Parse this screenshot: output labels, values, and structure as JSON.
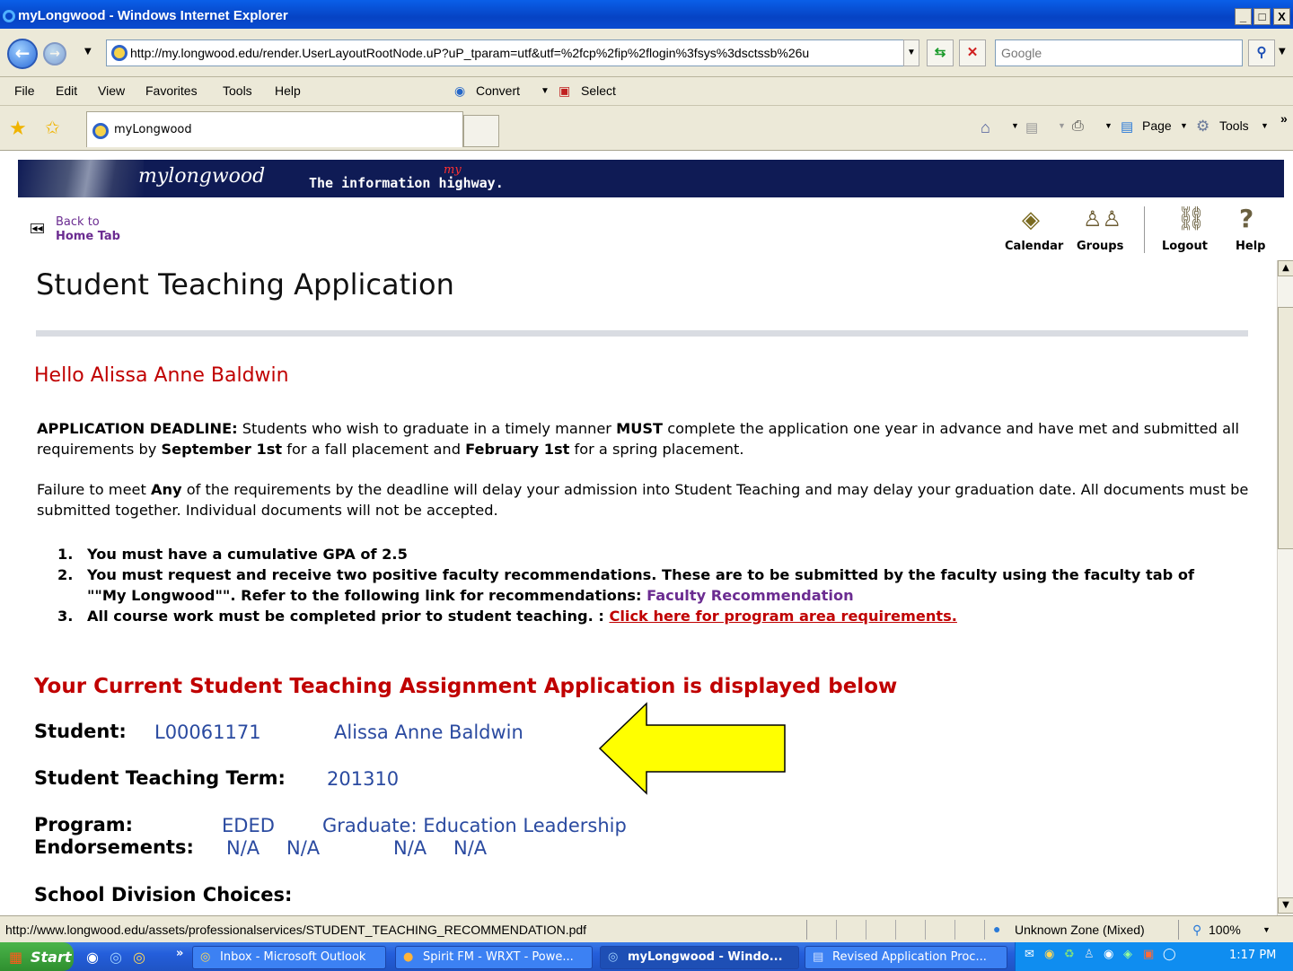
{
  "window": {
    "title": "myLongwood - Windows Internet Explorer",
    "min": "_",
    "max": "□",
    "close": "X"
  },
  "nav": {
    "address": "http://my.longwood.edu/render.UserLayoutRootNode.uP?uP_tparam=utf&utf=%2fcp%2fip%2flogin%3fsys%3dsctssb%26u",
    "search_placeholder": "Google"
  },
  "menu": {
    "file": "File",
    "edit": "Edit",
    "view": "View",
    "favorites": "Favorites",
    "tools": "Tools",
    "help": "Help",
    "convert": "Convert",
    "select": "Select"
  },
  "favbar": {
    "tab_label": "myLongwood",
    "page": "Page",
    "tools": "Tools"
  },
  "banner": {
    "logo": "mylongwood",
    "tagline": "The information highway.",
    "my": "my"
  },
  "portal": {
    "back_line1": "Back to",
    "back_line2": "Home Tab",
    "calendar": "Calendar",
    "groups": "Groups",
    "logout": "Logout",
    "help": "Help"
  },
  "page": {
    "title": "Student Teaching Application",
    "greeting": "Hello Alissa Anne Baldwin",
    "deadline_label": "APPLICATION DEADLINE:",
    "deadline_t1": " Students who wish to graduate in a timely manner ",
    "deadline_must": "MUST",
    "deadline_t2": " complete the application one year in advance and have met and submitted all requirements by ",
    "deadline_sept": "September 1st",
    "deadline_t3": " for a fall placement and ",
    "deadline_feb": "February 1st",
    "deadline_t4": " for a spring placement.",
    "fail_t1": "Failure to meet ",
    "fail_any": "Any",
    "fail_t2": " of the requirements by the deadline will delay your admission into Student Teaching and may delay your graduation date. All documents must be submitted together. Individual documents will not be accepted.",
    "req1": "You must have a cumulative GPA of 2.5",
    "req2": "You must request and receive two positive faculty recommendations. These are to be submitted by the faculty using the faculty tab of \"\"My Longwood\"\". Refer to the following link for recommendations: ",
    "req2_link": "Faculty Recommendation",
    "req3": "All course work must be completed prior to student teaching. : ",
    "req3_link": "Click here for program area requirements.",
    "current_heading": "Your Current Student Teaching Assignment Application is displayed below",
    "student_label": "Student:",
    "student_id": "L00061171",
    "student_name": "Alissa Anne Baldwin",
    "term_label": "Student Teaching Term:",
    "term_value": "201310",
    "program_label": "Program:",
    "program_code": "EDED",
    "program_name": "Graduate: Education Leadership",
    "endorse_label": "Endorsements:",
    "endorse_1": "N/A",
    "endorse_2": "N/A",
    "endorse_3": "N/A",
    "endorse_4": "N/A",
    "school_label": "School Division Choices:"
  },
  "status": {
    "url": "http://www.longwood.edu/assets/professionalservices/STUDENT_TEACHING_RECOMMENDATION.pdf",
    "zone": "Unknown Zone (Mixed)",
    "zoom": "100%"
  },
  "taskbar": {
    "start": "Start",
    "item1": "Inbox - Microsoft Outlook",
    "item2": "Spirit FM - WRXT - Powe...",
    "item3": "myLongwood - Windo...",
    "item4": "Revised Application Proc...",
    "clock": "1:17 PM"
  },
  "colors": {
    "banner": "#0f1b55",
    "heading_red": "#c00000",
    "link_purple": "#6b2c91",
    "value_blue": "#2a4aa0",
    "arrow_yellow": "#ffff00"
  }
}
